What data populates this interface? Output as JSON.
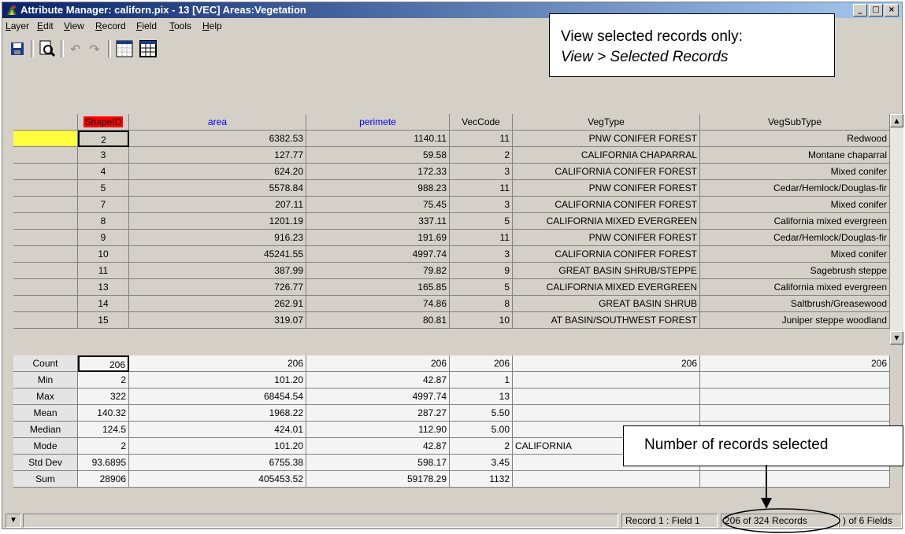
{
  "window": {
    "title": "Attribute Manager: californ.pix - 13 [VEC] Areas:Vegetation",
    "minimize": "_",
    "maximize": "□",
    "close": "×"
  },
  "menu": [
    "Layer",
    "Edit",
    "View",
    "Record",
    "Field",
    "Tools",
    "Help"
  ],
  "toolbar": {
    "icons": [
      "save-icon",
      "find-icon",
      "undo-icon",
      "redo-icon",
      "select-grid-icon",
      "table-icon"
    ]
  },
  "callouts": {
    "view_line1": "View selected records only:",
    "view_line2": "View > Selected Records",
    "count_label": "Number of records selected"
  },
  "table": {
    "headers": [
      "ShapeID",
      "area",
      "perimete",
      "VecCode",
      "VegType",
      "VegSubType"
    ],
    "header_colors": {
      "shapeid_bg": "#ff0000",
      "blue_text": "#0000ff"
    },
    "rows": [
      [
        "2",
        "6382.53",
        "1140.11",
        "11",
        "PNW CONIFER FOREST",
        "Redwood"
      ],
      [
        "3",
        "127.77",
        "59.58",
        "2",
        "CALIFORNIA CHAPARRAL",
        "Montane chaparral"
      ],
      [
        "4",
        "624.20",
        "172.33",
        "3",
        "CALIFORNIA CONIFER FOREST",
        "Mixed conifer"
      ],
      [
        "5",
        "5578.84",
        "988.23",
        "11",
        "PNW CONIFER FOREST",
        "Cedar/Hemlock/Douglas-fir"
      ],
      [
        "7",
        "207.11",
        "75.45",
        "3",
        "CALIFORNIA CONIFER FOREST",
        "Mixed conifer"
      ],
      [
        "8",
        "1201.19",
        "337.11",
        "5",
        "CALIFORNIA MIXED EVERGREEN",
        "California mixed evergreen"
      ],
      [
        "9",
        "916.23",
        "191.69",
        "11",
        "PNW CONIFER FOREST",
        "Cedar/Hemlock/Douglas-fir"
      ],
      [
        "10",
        "45241.55",
        "4997.74",
        "3",
        "CALIFORNIA CONIFER FOREST",
        "Mixed conifer"
      ],
      [
        "11",
        "387.99",
        "79.82",
        "9",
        "GREAT BASIN SHRUB/STEPPE",
        "Sagebrush steppe"
      ],
      [
        "13",
        "726.77",
        "165.85",
        "5",
        "CALIFORNIA MIXED EVERGREEN",
        "California mixed evergreen"
      ],
      [
        "14",
        "262.91",
        "74.86",
        "8",
        "GREAT BASIN SHRUB",
        "Saltbrush/Greasewood"
      ],
      [
        "15",
        "319.07",
        "80.81",
        "10",
        "AT BASIN/SOUTHWEST FOREST",
        "Juniper steppe woodland"
      ]
    ]
  },
  "stats": {
    "rows": [
      [
        "Count",
        "206",
        "206",
        "206",
        "206",
        "206",
        "206"
      ],
      [
        "Min",
        "2",
        "101.20",
        "42.87",
        "1",
        "",
        ""
      ],
      [
        "Max",
        "322",
        "68454.54",
        "4997.74",
        "13",
        "",
        ""
      ],
      [
        "Mean",
        "140.32",
        "1968.22",
        "287.27",
        "5.50",
        "",
        ""
      ],
      [
        "Median",
        "124.5",
        "424.01",
        "112.90",
        "5.00",
        "",
        ""
      ],
      [
        "Mode",
        "2",
        "101.20",
        "42.87",
        "2",
        "CALIFORNIA",
        ""
      ],
      [
        "Std Dev",
        "93.6895",
        "6755.38",
        "598.17",
        "3.45",
        "",
        ""
      ],
      [
        "Sum",
        "28906",
        "405453.52",
        "59178.29",
        "1132",
        "",
        ""
      ]
    ]
  },
  "statusbar": {
    "record_field": "Record 1 : Field 1",
    "records": "206 of 324 Records",
    "fields": ") of 6 Fields"
  }
}
